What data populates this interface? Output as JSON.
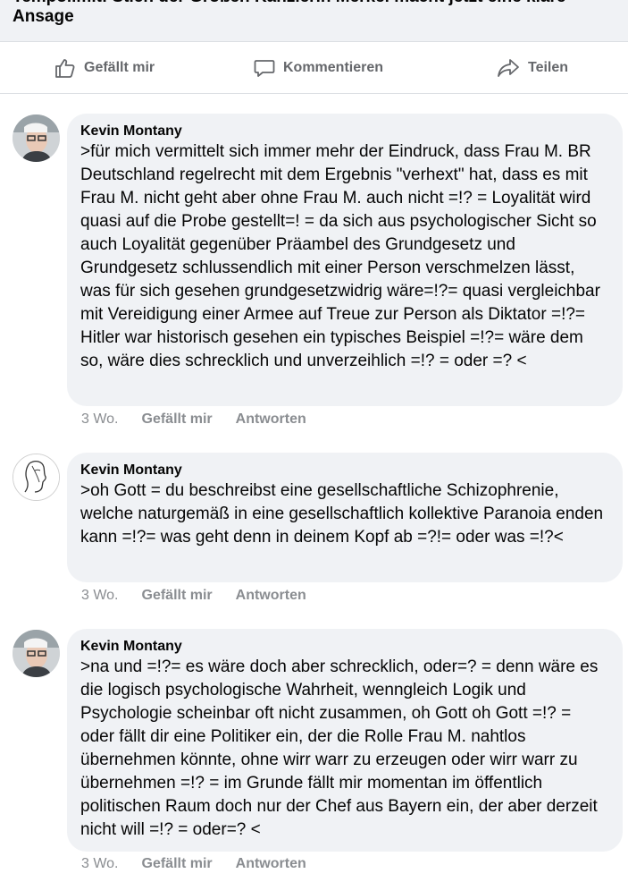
{
  "post": {
    "title_partial": "Tempolimit: Stich der Großen Kanzlerin Merkel macht jetzt eine klare",
    "title_line2": "Ansage"
  },
  "actions": {
    "like": "Gefällt mir",
    "comment": "Kommentieren",
    "share": "Teilen"
  },
  "comments": [
    {
      "author": "Kevin Montany",
      "text": ">für mich vermittelt sich immer mehr der Eindruck, dass Frau M. BR Deutschland regelrecht mit dem Ergebnis \"verhext\" hat, dass es mit Frau M. nicht geht aber ohne Frau M. auch nicht =!? = Loyalität wird quasi auf die Probe gestellt=! = da sich aus psychologischer Sicht so auch Loyalität gegenüber Präambel des Grundgesetz und Grundgesetz schlussendlich mit einer Person verschmelzen lässt, was für sich gesehen grundgesetzwidrig wäre=!?= quasi vergleichbar mit Vereidigung einer Armee auf Treue zur Person als Diktator =!?= Hitler war historisch gesehen ein typisches Beispiel =!?= wäre dem so, wäre dies schrecklich und unverzeihlich =!? = oder =? <",
      "time": "3 Wo.",
      "like": "Gefällt mir",
      "reply": "Antworten"
    },
    {
      "author": "Kevin Montany",
      "text": ">oh Gott = du beschreibst eine gesellschaftliche Schizophrenie, welche naturgemäß in eine gesellschaftlich kollektive Paranoia enden kann =!?= was geht denn in deinem Kopf ab =?!= oder was =!?<",
      "time": "3 Wo.",
      "like": "Gefällt mir",
      "reply": "Antworten"
    },
    {
      "author": "Kevin Montany",
      "text": ">na und =!?= es wäre doch aber schrecklich, oder=? = denn wäre es die logisch psychologische Wahrheit, wenngleich Logik und Psychologie scheinbar oft nicht zusammen, oh Gott oh Gott =!? = oder fällt dir eine Politiker ein, der die Rolle Frau M. nahtlos übernehmen könnte, ohne wirr warr zu erzeugen oder wirr warr zu übernehmen =!? = im Grunde fällt mir momentan im öffentlich politischen Raum doch nur der Chef aus Bayern ein, der aber derzeit nicht will =!? = oder=? <",
      "time": "3 Wo.",
      "like": "Gefällt mir",
      "reply": "Antworten"
    }
  ],
  "colors": {
    "bubble": "#f0f2f5",
    "meta": "#8a8d91",
    "action": "#65676b"
  }
}
